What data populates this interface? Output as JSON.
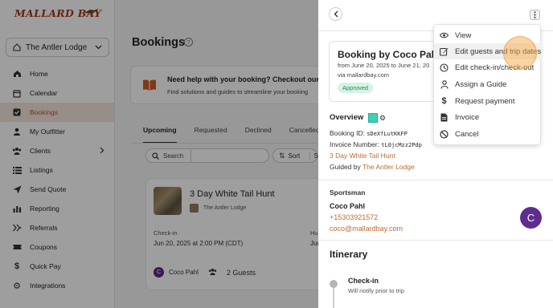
{
  "sidebar": {
    "logo_text": "MALLARD BAY",
    "lodge": "The Antler Lodge",
    "items": [
      {
        "label": "Home",
        "icon": "home-icon"
      },
      {
        "label": "Calendar",
        "icon": "calendar-icon"
      },
      {
        "label": "Bookings",
        "icon": "check-square-icon",
        "active": true
      },
      {
        "label": "My Outfitter",
        "icon": "user-icon"
      },
      {
        "label": "Clients",
        "icon": "users-icon",
        "has_chevron": true
      },
      {
        "label": "Listings",
        "icon": "list-icon"
      },
      {
        "label": "Send Quote",
        "icon": "send-icon"
      },
      {
        "label": "Reporting",
        "icon": "chart-icon"
      },
      {
        "label": "Referrals",
        "icon": "referral-icon"
      },
      {
        "label": "Coupons",
        "icon": "ticket-icon"
      },
      {
        "label": "Quick Pay",
        "icon": "dollar-icon"
      },
      {
        "label": "Integrations",
        "icon": "gear-icon"
      }
    ]
  },
  "main": {
    "title": "Bookings",
    "help_banner": {
      "heading": "Need help with your booking? Checkout our",
      "text": "Find solutions and guides to streamline your booking"
    },
    "tabs": [
      "Upcoming",
      "Requested",
      "Declined",
      "Cancelled"
    ],
    "search_label": "Search",
    "sort_label": "Sort",
    "sort_extra": "St",
    "card": {
      "title": "3 Day White Tail Hunt",
      "lodge": "The Antler Lodge",
      "checkin_label": "Check-in",
      "checkin_date": "Jun 20, 2025 at 2:00 PM (CDT)",
      "hu_label": "Hu",
      "jun_label": "Jun",
      "guest_initial": "C",
      "guest_name": "Coco Pahl",
      "guest_count": "2 Guests"
    }
  },
  "drawer": {
    "booking_title": "Booking by Coco Pahl",
    "dates": "from June 20, 2025 to June 21, 20",
    "via": "via mallardbay.com",
    "status": "Approved",
    "overview_label": "Overview",
    "booking_id_label": "Booking ID:",
    "booking_id": "sDeXfLutKKFP",
    "invoice_label": "Invoice Number:",
    "invoice_number": "tL0jcMzz2Pdp",
    "listing_link": "3 Day White Tail Hunt",
    "guided_by_label": "Guided by",
    "guided_by": "The Antler Lodge",
    "sportsman_label": "Sportsman",
    "sportsman_name": "Coco Pahl",
    "sportsman_phone": "+15303921572",
    "sportsman_email": "coco@mallardbay.com",
    "sportsman_initial": "C",
    "itinerary_label": "Itinerary",
    "checkin_title": "Check-in",
    "checkin_sub": "Will notify prior to trip"
  },
  "menu": {
    "items": [
      {
        "label": "View",
        "icon": "eye-icon"
      },
      {
        "label": "Edit guests and trip dates",
        "icon": "edit-icon"
      },
      {
        "label": "Edit check-in/check-out",
        "icon": "clock-icon"
      },
      {
        "label": "Assign a Guide",
        "icon": "person-icon"
      },
      {
        "label": "Request payment",
        "icon": "dollar-icon"
      },
      {
        "label": "Invoice",
        "icon": "document-icon"
      },
      {
        "label": "Cancel",
        "icon": "ban-icon"
      }
    ]
  },
  "colors": {
    "accent": "#c06a30",
    "active_nav_bg": "#f4e6dd",
    "approved_bg": "#d7f3e3",
    "approved_text": "#1b8a4c",
    "avatar": "#5d2d8f"
  }
}
